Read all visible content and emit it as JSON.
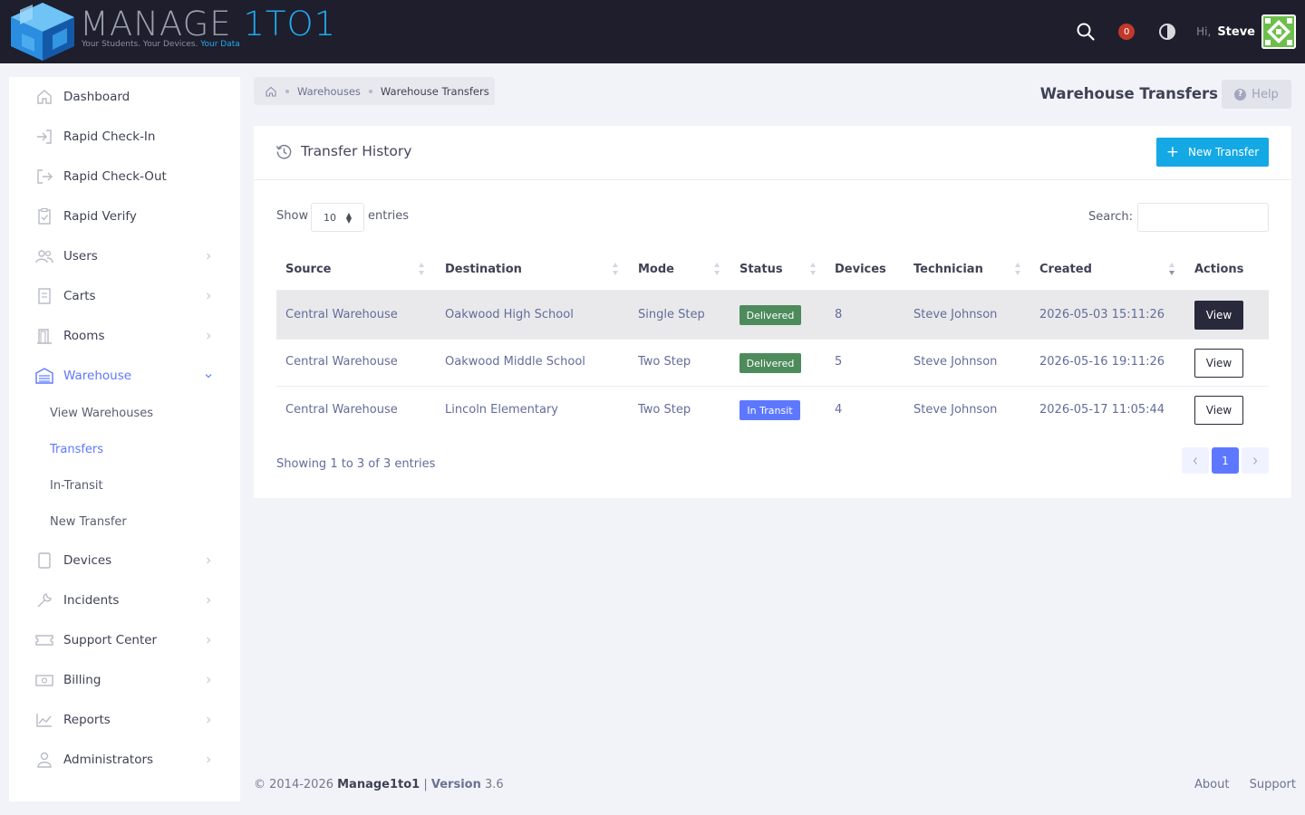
{
  "app": {
    "logo_main": "MANAGE ",
    "logo_accent": "1TO1",
    "tagline": "Your Students. Your Devices. ",
    "tagline_accent": "Your Data"
  },
  "topbar": {
    "notifications_count": "0",
    "greeting": "Hi,",
    "user": "Steve"
  },
  "sidebar": {
    "items": [
      {
        "label": "Dashboard",
        "icon": "home-icon"
      },
      {
        "label": "Rapid Check-In",
        "icon": "sign-in-icon"
      },
      {
        "label": "Rapid Check-Out",
        "icon": "sign-out-icon"
      },
      {
        "label": "Rapid Verify",
        "icon": "clipboard-check-icon"
      },
      {
        "label": "Users",
        "icon": "users-icon"
      },
      {
        "label": "Carts",
        "icon": "cart-icon"
      },
      {
        "label": "Rooms",
        "icon": "door-icon"
      },
      {
        "label": "Warehouse",
        "icon": "warehouse-icon"
      },
      {
        "label": "Devices",
        "icon": "tablet-icon"
      },
      {
        "label": "Incidents",
        "icon": "wrench-icon"
      },
      {
        "label": "Support Center",
        "icon": "ticket-icon"
      },
      {
        "label": "Billing",
        "icon": "money-icon"
      },
      {
        "label": "Reports",
        "icon": "chart-icon"
      },
      {
        "label": "Administrators",
        "icon": "admin-icon"
      }
    ],
    "warehouse_sub": [
      "View Warehouses",
      "Transfers",
      "In-Transit",
      "New Transfer"
    ]
  },
  "breadcrumb": {
    "parent": "Warehouses",
    "current": "Warehouse Transfers"
  },
  "page": {
    "title": "Warehouse Transfers",
    "help_label": "Help"
  },
  "card": {
    "title": "Transfer History",
    "new_button": "New Transfer",
    "show_label": "Show",
    "entries_value": "10",
    "entries_label": "entries",
    "search_label": "Search:",
    "search_value": ""
  },
  "table": {
    "headers": [
      "Source",
      "Destination",
      "Mode",
      "Status",
      "Devices",
      "Technician",
      "Created",
      "Actions"
    ],
    "rows": [
      {
        "source": "Central Warehouse",
        "destination": "Oakwood High School",
        "mode": "Single Step",
        "status": "Delivered",
        "devices": "8",
        "technician": "Steve Johnson",
        "created": "2026-05-03 15:11:26",
        "action": "View"
      },
      {
        "source": "Central Warehouse",
        "destination": "Oakwood Middle School",
        "mode": "Two Step",
        "status": "Delivered",
        "devices": "5",
        "technician": "Steve Johnson",
        "created": "2026-05-16 19:11:26",
        "action": "View"
      },
      {
        "source": "Central Warehouse",
        "destination": "Lincoln Elementary",
        "mode": "Two Step",
        "status": "In Transit",
        "devices": "4",
        "technician": "Steve Johnson",
        "created": "2026-05-17 11:05:44",
        "action": "View"
      }
    ],
    "info": "Showing 1 to 3 of 3 entries",
    "current_page": "1"
  },
  "footer": {
    "copyright": "© 2014-2026 ",
    "brand": "Manage1to1",
    "sep": " | ",
    "version_label": "Version",
    "version": " 3.6",
    "links": [
      "About",
      "Support"
    ]
  },
  "colors": {
    "accent": "#5d78ff",
    "primary_button": "#14a9e5",
    "delivered": "#4d8b5c",
    "in_transit": "#5d78ff",
    "topbar": "#1e1e2d"
  }
}
